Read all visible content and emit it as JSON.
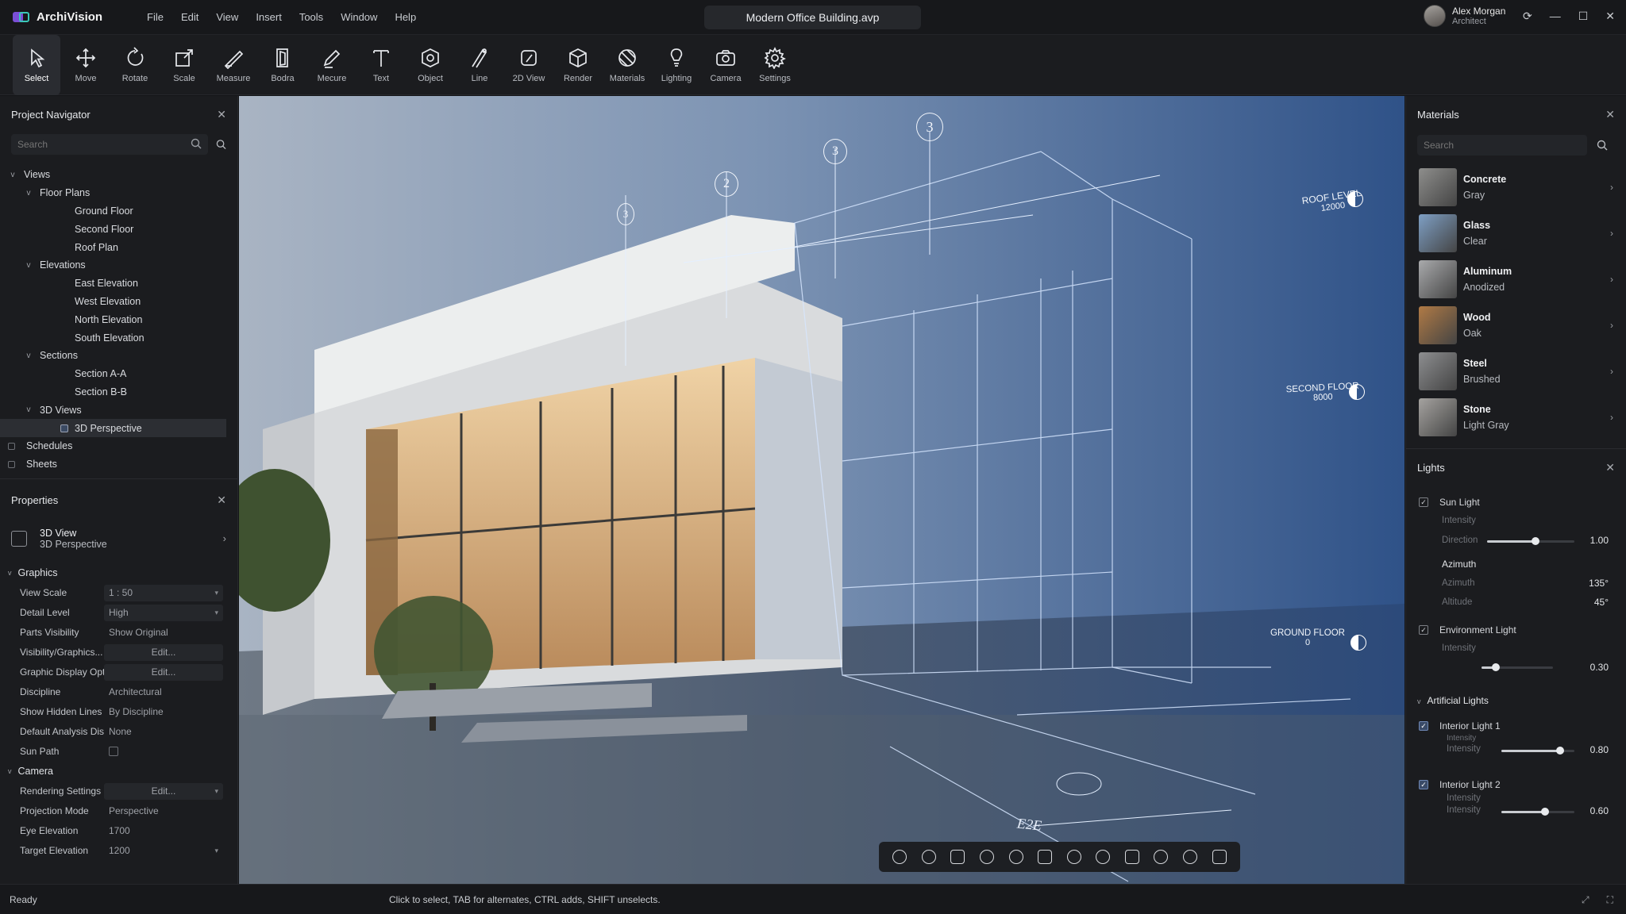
{
  "app": {
    "name": "ArchiVision",
    "document_title": "Modern Office Building.avp"
  },
  "menu": [
    "File",
    "Edit",
    "View",
    "Insert",
    "Tools",
    "Window",
    "Help"
  ],
  "user": {
    "name": "Alex Morgan",
    "role": "Architect"
  },
  "toolbar": [
    {
      "label": "Select",
      "icon": "cursor-icon",
      "active": true
    },
    {
      "label": "Move",
      "icon": "move-icon"
    },
    {
      "label": "Rotate",
      "icon": "rotate-icon"
    },
    {
      "label": "Scale",
      "icon": "scale-icon"
    },
    {
      "label": "Measure",
      "icon": "measure-icon"
    },
    {
      "label": "Bodra",
      "icon": "door-icon"
    },
    {
      "label": "Mecure",
      "icon": "pencil-icon"
    },
    {
      "label": "Text",
      "icon": "text-icon"
    },
    {
      "label": "Object",
      "icon": "object-icon"
    },
    {
      "label": "Line",
      "icon": "line-icon"
    },
    {
      "label": "2D View",
      "icon": "2d-view-icon"
    },
    {
      "label": "Render",
      "icon": "render-icon"
    },
    {
      "label": "Materials",
      "icon": "materials-icon"
    },
    {
      "label": "Lighting",
      "icon": "lighting-icon"
    },
    {
      "label": "Camera",
      "icon": "camera-icon"
    },
    {
      "label": "Settings",
      "icon": "gear-icon"
    }
  ],
  "navigator": {
    "title": "Project Navigator",
    "search_placeholder": "Search",
    "tree": [
      {
        "label": "Views",
        "level": 0,
        "chev": true
      },
      {
        "label": "Floor Plans",
        "level": 1,
        "chev": true
      },
      {
        "label": "Ground Floor",
        "level": 2
      },
      {
        "label": "Second Floor",
        "level": 2
      },
      {
        "label": "Roof Plan",
        "level": 2
      },
      {
        "label": "Elevations",
        "level": 1,
        "chev": true
      },
      {
        "label": "East Elevation",
        "level": 2
      },
      {
        "label": "West Elevation",
        "level": 2
      },
      {
        "label": "North Elevation",
        "level": 2
      },
      {
        "label": "South Elevation",
        "level": 2
      },
      {
        "label": "Sections",
        "level": 1,
        "chev": true
      },
      {
        "label": "Section A-A",
        "level": 2
      },
      {
        "label": "Section B-B",
        "level": 2
      },
      {
        "label": "3D Views",
        "level": 1,
        "chev": true
      },
      {
        "label": "3D Perspective",
        "level": 2,
        "selected": true
      },
      {
        "label": "Schedules",
        "level": 0
      },
      {
        "label": "Sheets",
        "level": 0
      }
    ]
  },
  "properties": {
    "title": "Properties",
    "selection_type": "3D View",
    "selection_name": "3D Perspective",
    "sections": [
      {
        "name": "Graphics",
        "rows": [
          {
            "key": "View Scale",
            "value": "1 : 50",
            "box": true,
            "dropdown": true
          },
          {
            "key": "Detail Level",
            "value": "High",
            "box": true,
            "dropdown": true
          },
          {
            "key": "Parts Visibility",
            "value": "Show Original"
          },
          {
            "key": "Visibility/Graphics...",
            "value": "Edit...",
            "box": true,
            "center": true
          },
          {
            "key": "Graphic Display Opt...",
            "value": "Edit...",
            "box": true,
            "center": true
          },
          {
            "key": "Discipline",
            "value": "Architectural"
          },
          {
            "key": "Show Hidden Lines",
            "value": "By Discipline"
          },
          {
            "key": "Default Analysis Dis...",
            "value": "None"
          },
          {
            "key": "Sun Path",
            "value": "",
            "checkbox": true
          }
        ]
      },
      {
        "name": "Camera",
        "rows": [
          {
            "key": "Rendering Settings",
            "value": "Edit...",
            "box": true,
            "center": true,
            "dropdown": true
          },
          {
            "key": "Projection Mode",
            "value": "Perspective"
          },
          {
            "key": "Eye Elevation",
            "value": "1700"
          },
          {
            "key": "Target Elevation",
            "value": "1200",
            "dropdown": true
          }
        ]
      }
    ]
  },
  "viewport": {
    "grid_bubbles": [
      "3",
      "2",
      "3",
      "3"
    ],
    "levels": [
      {
        "name": "ROOF LEVEL",
        "elev": "12000"
      },
      {
        "name": "SECOND FLOOR",
        "elev": "8000"
      },
      {
        "name": "GROUND FLOOR",
        "elev": "0"
      }
    ],
    "annotations": [
      "E2E"
    ],
    "nav_tools": [
      "pan-icon",
      "info-icon",
      "zoom-region-icon",
      "orbit-icon",
      "zoom-in-icon",
      "zoom-out-icon",
      "fit-icon",
      "section-box-icon",
      "walk-icon",
      "look-icon",
      "frame-icon",
      "snapshot-icon"
    ]
  },
  "materials": {
    "title": "Materials",
    "search_placeholder": "Search",
    "items": [
      {
        "name": "Concrete",
        "sub": "Gray",
        "color": "#8e8e8c"
      },
      {
        "name": "Glass",
        "sub": "Clear",
        "color": "#7e9fc4"
      },
      {
        "name": "Aluminum",
        "sub": "Anodized",
        "color": "#a9aaac"
      },
      {
        "name": "Wood",
        "sub": "Oak",
        "color": "#b07a45"
      },
      {
        "name": "Steel",
        "sub": "Brushed",
        "color": "#8d8e90"
      },
      {
        "name": "Stone",
        "sub": "Light Gray",
        "color": "#a5a3a0"
      }
    ]
  },
  "lights": {
    "title": "Lights",
    "sun": {
      "label": "Sun Light",
      "intensity_label": "Intensity",
      "direction_label": "Direction",
      "direction_value": "1.00",
      "direction_level": 0.55,
      "azimuth_header": "Azimuth",
      "azimuth_label": "Azimuth",
      "azimuth_value": "135°",
      "altitude_label": "Altitude",
      "altitude_value": "45°"
    },
    "environment": {
      "label": "Environment Light",
      "intensity_label": "Intensity",
      "value": "0.30",
      "level": 0.2
    },
    "artificial_header": "Artificial Lights",
    "artificial": [
      {
        "label": "Interior Light 1",
        "sub": "Intensity",
        "intensity_label": "Intensity",
        "value": "0.80",
        "level": 0.8
      },
      {
        "label": "Interior Light 2",
        "sub": "Intensity",
        "intensity_label": "Intensity",
        "value": "0.60",
        "level": 0.6
      }
    ]
  },
  "status": {
    "left": "Ready",
    "hint": "Click to select, TAB for alternates, CTRL adds, SHIFT unselects."
  },
  "colors": {
    "accent": "#3a6fb8",
    "panel": "#1b1c1f",
    "blueprint": "#2b4a7d"
  }
}
